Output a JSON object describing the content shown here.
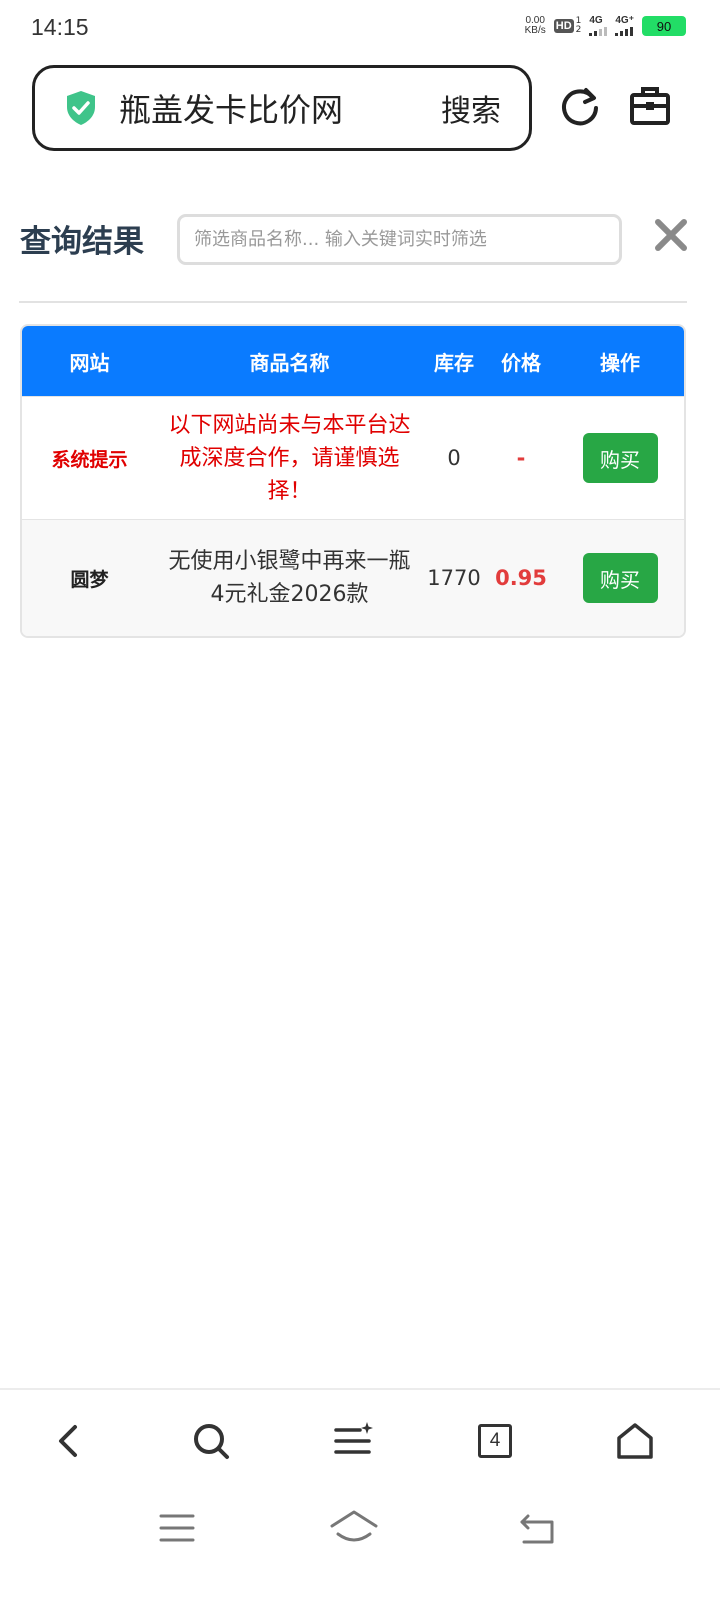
{
  "status": {
    "time": "14:15",
    "net_speed_value": "0.00",
    "net_speed_unit": "KB/s",
    "hd": "HD",
    "hd_sub_top": "1",
    "hd_sub_bottom": "2",
    "signal1": "4G",
    "signal2": "4G⁺",
    "battery": "90"
  },
  "address_bar": {
    "site_name": "瓶盖发卡比价网",
    "search_label": "搜索"
  },
  "results": {
    "title": "查询结果",
    "filter_placeholder": "筛选商品名称... 输入关键词实时筛选"
  },
  "table": {
    "headers": [
      "网站",
      "商品名称",
      "库存",
      "价格",
      "操作"
    ],
    "rows": [
      {
        "site": "系统提示",
        "name": "以下网站尚未与本平台达成深度合作，请谨慎选择！",
        "stock": "0",
        "price": "-",
        "action": "购买"
      },
      {
        "site": "圆梦",
        "name": "无使用小银鹭中再来一瓶4元礼金2026款",
        "stock": "1770",
        "price": "0.95",
        "action": "购买"
      }
    ]
  },
  "bottom_nav": {
    "tabs_count": "4"
  },
  "colors": {
    "accent": "#0a7bff",
    "buy": "#28a745",
    "warning": "#e00000",
    "price": "#e23c3c"
  }
}
